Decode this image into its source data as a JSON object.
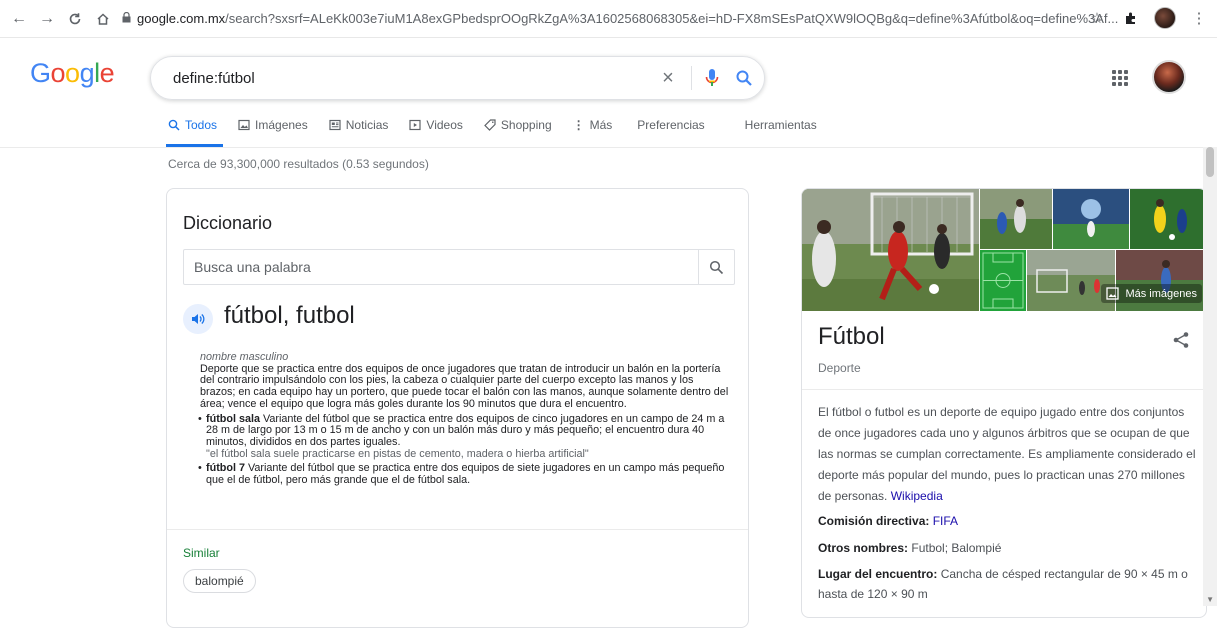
{
  "browser": {
    "url_host": "google.com.mx",
    "url_rest": "/search?sxsrf=ALeKk003e7iuM1A8exGPbedsprOOgRkZgA%3A1602568068305&ei=hD-FX8mSEsPatQXW9lOQBg&q=define%3Afútbol&oq=define%3Af...",
    "icons": [
      "back-icon",
      "forward-icon",
      "reload-icon",
      "home-icon",
      "lock-icon",
      "star-icon",
      "extensions-icon",
      "profile-icon",
      "kebab-menu-icon"
    ]
  },
  "logo": [
    "G",
    "o",
    "o",
    "g",
    "l",
    "e"
  ],
  "search": {
    "query": "define:fútbol",
    "clear_symbol": "×"
  },
  "tabs": [
    {
      "label": "Todos",
      "icon": "search-icon",
      "active": true
    },
    {
      "label": "Imágenes",
      "icon": "image-icon",
      "active": false
    },
    {
      "label": "Noticias",
      "icon": "news-icon",
      "active": false
    },
    {
      "label": "Videos",
      "icon": "play-icon",
      "active": false
    },
    {
      "label": "Shopping",
      "icon": "tag-icon",
      "active": false
    },
    {
      "label": "Más",
      "icon": "more-vert-icon",
      "active": false
    },
    {
      "label": "Preferencias",
      "icon": "",
      "active": false
    },
    {
      "label": "Herramientas",
      "icon": "",
      "active": false
    }
  ],
  "results": {
    "stats": "Cerca de 93,300,000 resultados (0.53 segundos)"
  },
  "dictionary": {
    "title": "Diccionario",
    "search_placeholder": "Busca una palabra",
    "headword": "fútbol, futbol",
    "part_of_speech": "nombre masculino",
    "definition": "Deporte que se practica entre dos equipos de once jugadores que tratan de introducir un balón en la portería del contrario impulsándolo con los pies, la cabeza o cualquier parte del cuerpo excepto las manos y los brazos; en cada equipo hay un portero, que puede tocar el balón con las manos, aunque solamente dentro del área; vence el equipo que logra más goles durante los 90 minutos que dura el encuentro.",
    "subentries": [
      {
        "term": "fútbol sala",
        "text": " Variante del fútbol que se practica entre dos equipos de cinco jugadores en un campo de 24 m a 28 m de largo por 13 m o 15 m de ancho y con un balón más duro y más pequeño; el encuentro dura 40 minutos, divididos en dos partes iguales.",
        "example": "\"el fútbol sala suele practicarse en pistas de cemento, madera o hierba artificial\""
      },
      {
        "term": "fútbol 7",
        "text": " Variante del fútbol que se practica entre dos equipos de siete jugadores en un campo más pequeño que el de fútbol, pero más grande que el de fútbol sala.",
        "example": ""
      }
    ],
    "similar_label": "Similar",
    "similar_chip": "balompié"
  },
  "knowledge_panel": {
    "more_images": "Más imágenes",
    "title": "Fútbol",
    "subtitle": "Deporte",
    "description": "El fútbol o futbol  es un deporte de equipo jugado entre dos conjuntos de once jugadores cada uno y algunos árbitros que se ocupan de que las normas se cumplan correctamente. Es ampliamente considerado el deporte más popular del mundo, pues lo practican unas 270 millones de personas. ",
    "source": "Wikipedia",
    "facts": [
      {
        "label": "Comisión directiva: ",
        "value": "FIFA",
        "link": true
      },
      {
        "label": "Otros nombres: ",
        "value": "Futbol; Balompié",
        "link": false
      },
      {
        "label": "Lugar del encuentro: ",
        "value": "Cancha de césped rectangular de 90 × 45 m o hasta de 120 × 90 m",
        "link": false
      }
    ]
  },
  "colors": {
    "accent": "#1a73e8",
    "link": "#1a0dab",
    "similar_green": "#188038"
  }
}
